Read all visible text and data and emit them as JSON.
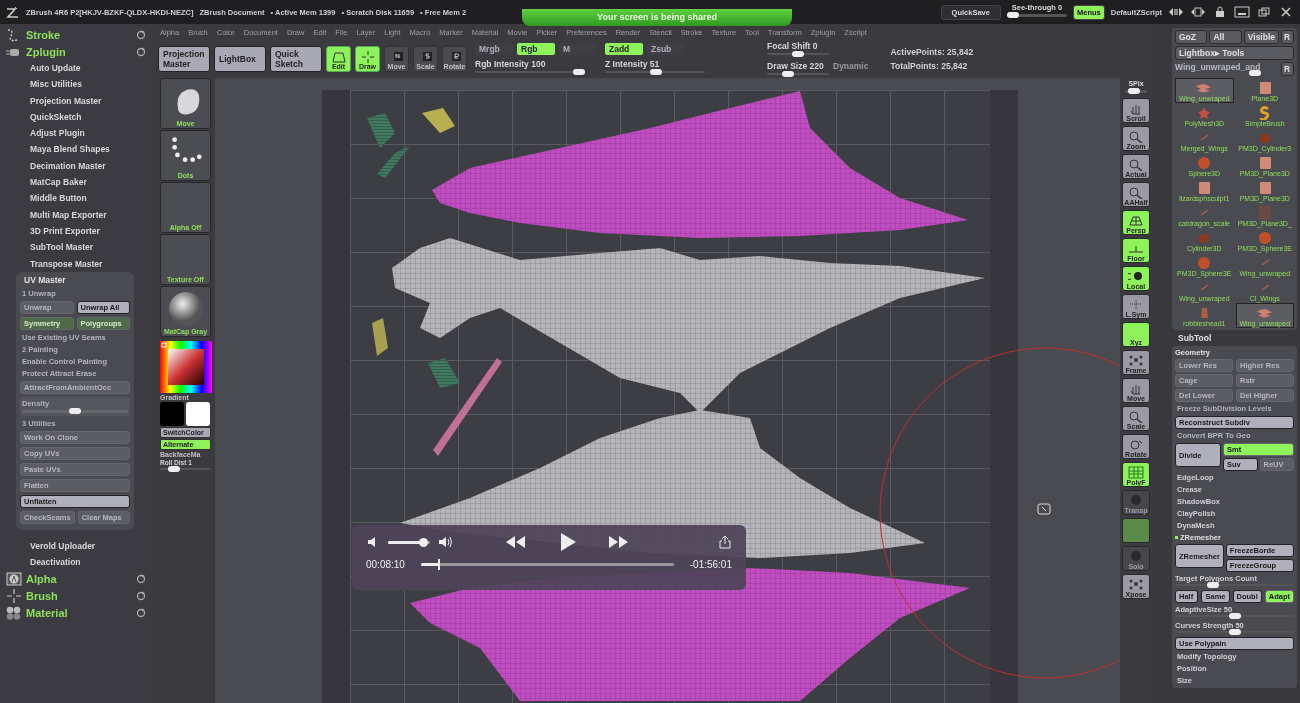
{
  "title_bar": {
    "app": "ZBrush 4R6 P2[HKJV-BZKF-QLDX-HKDI-NEZC]",
    "document": "ZBrush Document",
    "stats": [
      "• Active Mem 1399",
      "• Scratch Disk 11659",
      "• Free Mem 2"
    ],
    "share_banner": "Your screen is being shared",
    "quicksave": "QuickSave",
    "see_through": {
      "label": "See-through",
      "value": "0",
      "level": 0
    },
    "menus": {
      "label": "Menus",
      "on": true
    },
    "script": "DefaultZScript"
  },
  "menu_bar": [
    "Alpha",
    "Brush",
    "Color",
    "Document",
    "Draw",
    "Edit",
    "File",
    "Layer",
    "Light",
    "Macro",
    "Marker",
    "Material",
    "Movie",
    "Picker",
    "Preferences",
    "Render",
    "Stencil",
    "Stroke",
    "Texture",
    "Tool",
    "Transform",
    "Zplugin",
    "Zscript"
  ],
  "toolbar": {
    "big_buttons": [
      "Projection Master",
      "LightBox",
      "Quick Sketch"
    ],
    "mode_buttons": [
      {
        "label": "Edit",
        "kind": "edit",
        "on": true
      },
      {
        "label": "Draw",
        "kind": "draw",
        "on": true
      },
      {
        "label": "Move",
        "kind": "move",
        "on": false
      },
      {
        "label": "Scale",
        "kind": "scale",
        "on": false
      },
      {
        "label": "Rotate",
        "kind": "rotate",
        "on": false
      }
    ],
    "color_modes": [
      {
        "label": "Mrgb",
        "selected": false
      },
      {
        "label": "Rgb",
        "selected": true
      },
      {
        "label": "M",
        "selected": false
      }
    ],
    "rgb_intensity": {
      "label": "Rgb Intensity",
      "value": "100",
      "level": 1
    },
    "z_modes": [
      {
        "label": "Zadd",
        "selected": true
      },
      {
        "label": "Zsub",
        "selected": false
      }
    ],
    "z_intensity": {
      "label": "Z Intensity",
      "value": "51",
      "level": 0.51
    },
    "focal_shift": {
      "label": "Focal Shift",
      "value": "0",
      "level": 0.5
    },
    "draw_size": {
      "label": "Draw Size",
      "value": "220",
      "level": 0.3
    },
    "dynamic": "Dynamic",
    "points": [
      "ActivePoints: 25,842",
      "TotalPoints: 25,842"
    ]
  },
  "left_panel": {
    "palettes_top": [
      {
        "label": "Stroke",
        "kind": "stroke"
      },
      {
        "label": "Zplugin",
        "kind": "plugin"
      }
    ],
    "plugins": [
      "Auto Update",
      "Misc Utilities",
      "Projection Master",
      "QuickSketch",
      "Adjust Plugin",
      "Maya Blend Shapes",
      "Decimation Master",
      "MatCap Baker",
      "Middle Button",
      "Multi Map Exporter",
      "3D Print Exporter",
      "SubTool Master",
      "Transpose Master"
    ],
    "uv_master": {
      "title": "UV Master",
      "rows": [
        {
          "kind": "header",
          "text": "1 Unwrap"
        },
        {
          "kind": "buttons",
          "buttons": [
            {
              "label": "Unwrap",
              "disabled": true,
              "on": false
            },
            {
              "label": "Unwrap All",
              "disabled": false,
              "on": false
            }
          ]
        },
        {
          "kind": "buttons",
          "buttons": [
            {
              "label": "Symmetry",
              "disabled": true,
              "on": true
            },
            {
              "label": "Polygroups",
              "disabled": true,
              "on": true
            }
          ]
        },
        {
          "kind": "label",
          "text": "Use Existing UV Seams"
        },
        {
          "kind": "header",
          "text": "2 Painting"
        },
        {
          "kind": "label",
          "text": "Enable Control Painting"
        },
        {
          "kind": "label",
          "text": "Protect Attract Erase"
        },
        {
          "kind": "buttons",
          "buttons": [
            {
              "label": "AttractFromAmbientOcc",
              "disabled": true,
              "on": false
            }
          ]
        },
        {
          "kind": "slider",
          "text": "Density",
          "level": 0.5
        },
        {
          "kind": "header",
          "text": "3 Utilities"
        },
        {
          "kind": "buttons",
          "buttons": [
            {
              "label": "Work On Clone",
              "disabled": true,
              "on": false
            }
          ]
        },
        {
          "kind": "buttons",
          "buttons": [
            {
              "label": "Copy UVs",
              "disabled": true,
              "on": false
            }
          ]
        },
        {
          "kind": "buttons",
          "buttons": [
            {
              "label": "Paste UVs",
              "disabled": true,
              "on": false
            }
          ]
        },
        {
          "kind": "buttons",
          "buttons": [
            {
              "label": "Flatten",
              "disabled": true,
              "on": false
            }
          ]
        },
        {
          "kind": "buttons",
          "buttons": [
            {
              "label": "Unflatten",
              "disabled": false,
              "on": false
            }
          ]
        },
        {
          "kind": "buttons",
          "buttons": [
            {
              "label": "CheckSeams",
              "disabled": true,
              "on": false
            },
            {
              "label": "Clear Maps",
              "disabled": true,
              "on": false
            }
          ]
        }
      ]
    },
    "plugins_after": [
      "Verold Uploader",
      "Deactivation"
    ],
    "palettes_bottom": [
      {
        "label": "Alpha",
        "kind": "alpha"
      },
      {
        "label": "Brush",
        "kind": "brush"
      },
      {
        "label": "Material",
        "kind": "material"
      }
    ]
  },
  "tray": {
    "thumbs": [
      {
        "label": "Move",
        "kind": "brush"
      },
      {
        "label": "Dots",
        "kind": "dots"
      },
      {
        "label": "Alpha Off",
        "kind": "empty"
      },
      {
        "label": "Texture Off",
        "kind": "empty"
      },
      {
        "label": "MatCap Gray",
        "kind": "sphere"
      }
    ],
    "gradient": "Gradient",
    "switch_color": "SwitchColor",
    "alternate": {
      "label": "Alternate",
      "on": true
    },
    "backface": "BackfaceMa",
    "roll_dist": {
      "label": "Roll Dist 1",
      "level": 0.2
    }
  },
  "shelf": [
    {
      "label": "SPix",
      "kind": "slider",
      "level": 0.3
    },
    {
      "label": "Scroll",
      "kind": "scroll",
      "on": false
    },
    {
      "label": "Zoom",
      "kind": "zoom",
      "on": false
    },
    {
      "label": "Actual",
      "kind": "zoom",
      "on": false
    },
    {
      "label": "AAHalf",
      "kind": "zoom",
      "on": false
    },
    {
      "label": "Persp",
      "kind": "persp",
      "on": true
    },
    {
      "label": "Floor",
      "kind": "floor",
      "on": true
    },
    {
      "label": "Local",
      "kind": "local",
      "on": true
    },
    {
      "label": "L.Sym",
      "kind": "sym",
      "on": false
    },
    {
      "label": "Xyz",
      "kind": "xyz",
      "on": true
    },
    {
      "label": "Frame",
      "kind": "frame",
      "on": false
    },
    {
      "label": "Move",
      "kind": "scroll",
      "on": false
    },
    {
      "label": "Scale",
      "kind": "zoom",
      "on": false
    },
    {
      "label": "Rotate",
      "kind": "rotate",
      "on": false
    },
    {
      "label": "PolyF",
      "kind": "polyf",
      "on": true
    },
    {
      "label": "Transp",
      "kind": "ghost",
      "on": false
    },
    {
      "kind": "blank",
      "on": true
    },
    {
      "label": "Solo",
      "kind": "ghost",
      "on": false
    },
    {
      "label": "Xpose",
      "kind": "frame",
      "on": false
    }
  ],
  "right_panel": {
    "top_buttons": [
      "GoZ",
      "All",
      "Visible",
      "R"
    ],
    "lightbox": "Lightbox▸ Tools",
    "current_tool": {
      "label": "Wing_unwraped_and",
      "level": 0.8
    },
    "reset": "R",
    "tools": [
      {
        "label": "Wing_unwraped",
        "kind": "wing",
        "selected": true
      },
      {
        "label": "Plane3D",
        "kind": "plane",
        "selected": false
      },
      {
        "label": "PolyMesh3D",
        "kind": "star",
        "selected": false
      },
      {
        "label": "SimpleBrush",
        "kind": "letter",
        "selected": false
      },
      {
        "label": "Merged_Wings",
        "kind": "small",
        "selected": false
      },
      {
        "label": "PM3D_Cylinder3",
        "kind": "cylinder",
        "selected": false
      },
      {
        "label": "Sphere3D",
        "kind": "sphere",
        "selected": false
      },
      {
        "label": "PM3D_Plane3D",
        "kind": "plane",
        "selected": false
      },
      {
        "label": "lizardsphsculpt1",
        "kind": "plane",
        "selected": false
      },
      {
        "label": "PM3D_Plane3D",
        "kind": "plane",
        "selected": false
      },
      {
        "label": "catdragon_scale",
        "kind": "small",
        "selected": false
      },
      {
        "label": "PM3D_Plane3D_",
        "kind": "dark",
        "selected": false
      },
      {
        "label": "Cylinder3D",
        "kind": "cylinder",
        "selected": false
      },
      {
        "label": "PM3D_Sphere3E",
        "kind": "sphere",
        "selected": false
      },
      {
        "label": "PM3D_Sphere3E",
        "kind": "sphere",
        "selected": false
      },
      {
        "label": "Wing_unwraped",
        "kind": "small",
        "selected": false
      },
      {
        "label": "Wing_unwraped",
        "kind": "small",
        "selected": false
      },
      {
        "label": "Cl_Wings",
        "kind": "small",
        "selected": false
      },
      {
        "label": "robbieshead1",
        "kind": "head",
        "selected": false
      },
      {
        "label": "Wing_unwraped",
        "kind": "wing",
        "selected": true
      }
    ],
    "subtool": "SubTool",
    "geometry": {
      "title": "Geometry",
      "rows": [
        {
          "kind": "buttons",
          "buttons": [
            {
              "label": "Lower Res",
              "disabled": true,
              "on": false
            },
            {
              "label": "Higher Res",
              "disabled": true,
              "on": false
            }
          ]
        },
        {
          "kind": "buttons",
          "buttons": [
            {
              "label": "Cage",
              "disabled": true,
              "on": false
            },
            {
              "label": "Rstr",
              "disabled": true,
              "on": false
            }
          ]
        },
        {
          "kind": "buttons",
          "buttons": [
            {
              "label": "Del Lower",
              "disabled": true,
              "on": false
            },
            {
              "label": "Del Higher",
              "disabled": true,
              "on": false
            }
          ]
        },
        {
          "kind": "label",
          "text": "Freeze SubDivision Levels"
        },
        {
          "kind": "buttons",
          "buttons": [
            {
              "label": "Reconstruct Subdiv",
              "disabled": false,
              "on": false
            }
          ]
        },
        {
          "kind": "label",
          "text": "Convert BPR To Geo"
        },
        {
          "kind": "divide",
          "buttons": [
            {
              "label": "Divide",
              "disabled": false,
              "on": false
            },
            {
              "label": "Smt",
              "disabled": false,
              "on": true
            },
            {
              "label": "Suv",
              "disabled": false,
              "on": false
            },
            {
              "label": "ReUV",
              "disabled": true,
              "on": false
            }
          ]
        },
        {
          "kind": "item",
          "text": "EdgeLoop"
        },
        {
          "kind": "item",
          "text": "Crease"
        },
        {
          "kind": "item",
          "text": "ShadowBox"
        },
        {
          "kind": "item",
          "text": "ClayPolish"
        },
        {
          "kind": "item",
          "text": "DynaMesh"
        },
        {
          "kind": "section",
          "text": "ZRemesher"
        },
        {
          "kind": "divide",
          "buttons": [
            {
              "label": "ZRemesher",
              "disabled": false,
              "on": false
            },
            {
              "label": "FreezeBorde",
              "disabled": false,
              "on": false
            },
            {
              "label": "FreezeGroup",
              "disabled": false,
              "on": false
            }
          ]
        },
        {
          "kind": "slider",
          "text": "Target Polygons Count",
          "level": 0.3
        },
        {
          "kind": "buttons",
          "buttons": [
            {
              "label": "Half",
              "disabled": false,
              "on": false
            },
            {
              "label": "Same",
              "disabled": false,
              "on": false
            },
            {
              "label": "Doubl",
              "disabled": false,
              "on": false
            },
            {
              "label": "Adapt",
              "disabled": false,
              "on": true
            }
          ]
        },
        {
          "kind": "slider",
          "text": "AdaptiveSize 50",
          "level": 0.5
        },
        {
          "kind": "slider",
          "text": "Curves Strength 50",
          "level": 0.5
        },
        {
          "kind": "buttons",
          "buttons": [
            {
              "label": "Use Polypain",
              "disabled": false,
              "on": false
            }
          ]
        },
        {
          "kind": "item",
          "text": "Modify Topology"
        },
        {
          "kind": "item",
          "text": "Position"
        },
        {
          "kind": "item",
          "text": "Size"
        }
      ]
    }
  },
  "video_player": {
    "elapsed": "00:08:10",
    "remaining": "-01:56:01",
    "volume": {
      "level": 0.93
    },
    "progress": {
      "level": 0.07
    }
  }
}
